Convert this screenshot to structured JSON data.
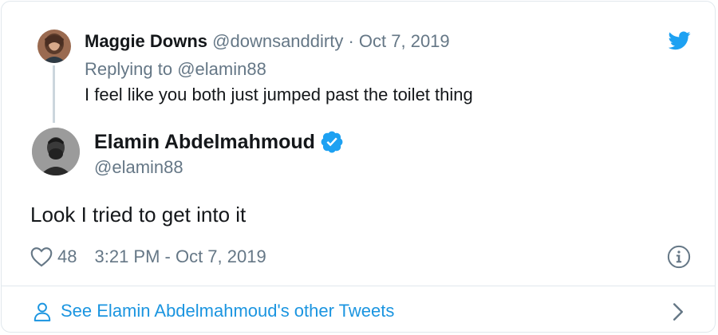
{
  "parent_tweet": {
    "author_name": "Maggie Downs",
    "author_handle": "@downsanddirty",
    "separator": " · ",
    "date": "Oct 7, 2019",
    "replying_prefix": "Replying to ",
    "replying_handle": "@elamin88",
    "text": "I feel like you both just jumped past the toilet thing",
    "avatar_icon": "avatar-photo"
  },
  "main_tweet": {
    "author_name": "Elamin Abdelmahmoud",
    "author_handle": "@elamin88",
    "verified": true,
    "text": "Look I tried to get into it",
    "like_count": "48",
    "timestamp": "3:21 PM - Oct 7, 2019",
    "avatar_icon": "avatar-photo"
  },
  "footer": {
    "link_text": "See Elamin Abdelmahmoud's other Tweets",
    "icon": "person-icon"
  },
  "icons": {
    "brand": "twitter-bird-icon",
    "verified": "verified-badge-icon",
    "like": "heart-icon",
    "info": "info-icon",
    "chevron": "chevron-right-icon"
  },
  "colors": {
    "brand_blue": "#1da1f2",
    "link_blue": "#1b95e0",
    "text_primary": "#14171a",
    "text_muted": "#657786",
    "border": "#e1e8ed",
    "thread_line": "#ccd6dd"
  }
}
